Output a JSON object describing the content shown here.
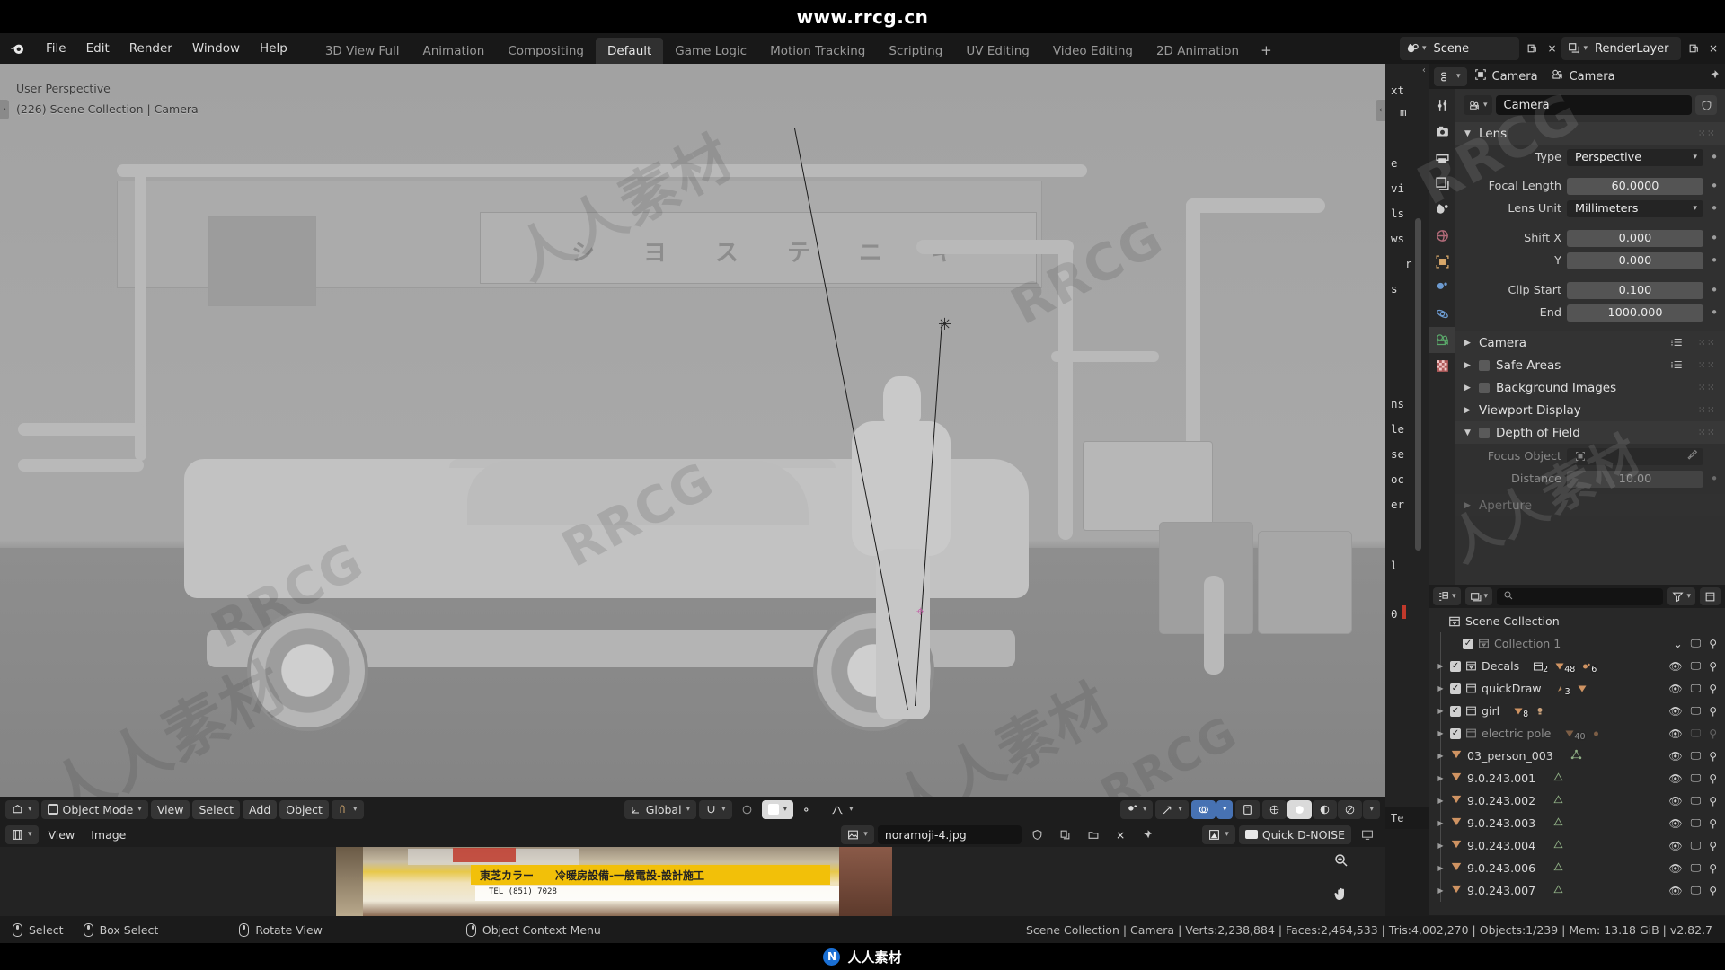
{
  "banner": {
    "text": "www.rrcg.cn"
  },
  "bottom_banner": {
    "text": "人人素材",
    "logo_glyph": "N"
  },
  "topbar": {
    "logo_icon": "blender-logo-icon",
    "menus": [
      "File",
      "Edit",
      "Render",
      "Window",
      "Help"
    ],
    "workspaces": [
      {
        "label": "3D View Full",
        "active": false
      },
      {
        "label": "Animation",
        "active": false
      },
      {
        "label": "Compositing",
        "active": false
      },
      {
        "label": "Default",
        "active": true
      },
      {
        "label": "Game Logic",
        "active": false
      },
      {
        "label": "Motion Tracking",
        "active": false
      },
      {
        "label": "Scripting",
        "active": false
      },
      {
        "label": "UV Editing",
        "active": false
      },
      {
        "label": "Video Editing",
        "active": false
      },
      {
        "label": "2D Animation",
        "active": false
      }
    ],
    "add_workspace": "+",
    "scene": {
      "icon": "scene-icon",
      "name": "Scene",
      "new_btn": "new-scene-icon",
      "unlink_btn": "×"
    },
    "view_layer": {
      "icon": "view-layer-icon",
      "name": "RenderLayer",
      "new_btn": "new-layer-icon",
      "remove_btn": "×"
    }
  },
  "viewport": {
    "perspective": "User Perspective",
    "scene_info": "(226) Scene Collection | Camera",
    "jp_sign_chars": [
      "シ",
      "ヨ",
      "ス",
      "テ",
      "ニ",
      "キ"
    ],
    "left_toggle_icon": "chevron-right-icon",
    "right_toggle_icon": "chevron-left-icon"
  },
  "viewport_footer": {
    "editor_type_icon": "editor-type-3dview-icon",
    "mode": "Object Mode",
    "menus": [
      "View",
      "Select",
      "Add",
      "Object"
    ],
    "object_mode_extra_icon": "mode-options-icon",
    "transform_orientation": "Global",
    "snap_icon": "snap-magnet-icon",
    "proportional_icon": "proportional-edit-icon",
    "falloff_icon": "falloff-curve-icon",
    "visibility_icon": "object-visibility-icon",
    "gizmo_icon": "gizmo-icon",
    "overlays_icon": "overlays-icon",
    "xray_icon": "xray-toggle-icon",
    "shading_modes": [
      "wireframe",
      "solid",
      "material-preview",
      "rendered"
    ],
    "active_shading": "solid"
  },
  "image_editor": {
    "editor_type_icon": "editor-type-image-icon",
    "menus": [
      "View",
      "Image"
    ],
    "image_datablock_icon": "image-datablock-icon",
    "image_name": "noramoji-4.jpg",
    "fake_user_icon": "shield-icon",
    "copy_icon": "duplicate-icon",
    "open_icon": "folder-open-icon",
    "unlink_icon": "×",
    "pin_icon": "pin-icon",
    "view_mode_icon": "image-view-mode-icon",
    "denoise_button": "Quick D-NOISE",
    "denoise_display_icon": "display-icon",
    "zoom_icon": "zoom-in-icon",
    "pan_icon": "hand-icon"
  },
  "text_strip": {
    "lines": [
      "xt",
      "m",
      "e",
      "vi",
      "ls",
      "ws",
      "r",
      "s",
      "ns",
      "le",
      "se",
      "oc",
      "er",
      "l",
      "0"
    ],
    "footer": "Te"
  },
  "properties": {
    "breadcrumb": [
      {
        "icon": "object-icon",
        "label": "Camera"
      },
      {
        "icon": "camera-data-icon",
        "label": "Camera"
      }
    ],
    "pin_icon": "pin-icon",
    "editor_type_icon": "editor-type-properties-icon",
    "datablock": {
      "icon": "camera-data-icon",
      "name": "Camera",
      "shield_icon": "shield-icon"
    },
    "tabs": [
      "tool-icon",
      "render-icon",
      "output-icon",
      "view-layer-icon",
      "scene-icon",
      "world-icon",
      "object-icon",
      "modifier-icon",
      "physics-icon",
      "object-data-camera-icon",
      "texture-icon"
    ],
    "active_tab": "object-data-camera-icon",
    "lens_panel": {
      "title": "Lens",
      "rows": [
        {
          "label": "Type",
          "value": "Perspective",
          "kind": "dropdown"
        },
        {
          "label": "Focal Length",
          "value": "60.0000",
          "kind": "number"
        },
        {
          "label": "Lens Unit",
          "value": "Millimeters",
          "kind": "dropdown"
        },
        {
          "label": "Shift X",
          "value": "0.000",
          "kind": "number"
        },
        {
          "label": "Y",
          "value": "0.000",
          "kind": "number"
        },
        {
          "label": "Clip Start",
          "value": "0.100",
          "kind": "number"
        },
        {
          "label": "End",
          "value": "1000.000",
          "kind": "number"
        }
      ]
    },
    "collapsed_panels": [
      {
        "title": "Camera",
        "checkbox": false,
        "has_list": true
      },
      {
        "title": "Safe Areas",
        "checkbox": true,
        "has_list": true
      },
      {
        "title": "Background Images",
        "checkbox": true,
        "has_list": false
      },
      {
        "title": "Viewport Display",
        "checkbox": false,
        "has_list": false
      }
    ],
    "dof_panel": {
      "title": "Depth of Field",
      "checkbox": true,
      "rows": [
        {
          "label": "Focus Object",
          "value": "",
          "kind": "object",
          "eyedropper": true
        },
        {
          "label": "Distance",
          "value": "10.00",
          "kind": "number"
        }
      ],
      "next_panel_partial": "Aperture"
    }
  },
  "outliner": {
    "display_mode_icon": "outliner-display-mode-icon",
    "filter_type_icon": "outliner-filter-type-icon",
    "search_placeholder": "",
    "search_icon": "search-icon",
    "filter_icon": "filter-funnel-icon",
    "root": "Scene Collection",
    "rows": [
      {
        "name": "Collection 1",
        "type": "collection",
        "muted": true,
        "checkbox": true,
        "expand": false,
        "badges": [],
        "eye": false,
        "screen": true,
        "camera": true
      },
      {
        "name": "Decals",
        "type": "collection",
        "muted": false,
        "checkbox": true,
        "expand": true,
        "badges": [
          {
            "icon": "collection-icon",
            "count": "2"
          },
          {
            "icon": "mesh-icon",
            "count": "48"
          },
          {
            "icon": "modifier-icon",
            "count": "6"
          }
        ],
        "eye": true,
        "screen": true,
        "camera": true
      },
      {
        "name": "quickDraw",
        "type": "collection",
        "muted": false,
        "checkbox": true,
        "expand": true,
        "badges": [
          {
            "icon": "armature-icon",
            "count": "3"
          },
          {
            "icon": "mesh-icon",
            "count": ""
          }
        ],
        "eye": true,
        "screen": true,
        "camera": true
      },
      {
        "name": "girl",
        "type": "collection",
        "muted": false,
        "checkbox": true,
        "expand": true,
        "badges": [
          {
            "icon": "mesh-icon",
            "count": "8"
          },
          {
            "icon": "light-icon",
            "count": ""
          }
        ],
        "eye": true,
        "screen": true,
        "camera": true
      },
      {
        "name": "electric pole",
        "type": "collection",
        "muted": true,
        "checkbox": true,
        "expand": true,
        "badges": [
          {
            "icon": "mesh-icon",
            "count": "40"
          },
          {
            "icon": "modifier-icon",
            "count": ""
          }
        ],
        "eye": true,
        "screen": false,
        "camera": false
      },
      {
        "name": "03_person_003",
        "type": "object",
        "muted": false,
        "checkbox": false,
        "expand": true,
        "badges": [
          {
            "icon": "mesh-data-icon",
            "count": ""
          }
        ],
        "eye": true,
        "screen": true,
        "camera": true
      },
      {
        "name": "9.0.243.001",
        "type": "object",
        "muted": false,
        "checkbox": false,
        "expand": true,
        "badges": [
          {
            "icon": "mesh-data-icon",
            "count": ""
          }
        ],
        "eye": true,
        "screen": true,
        "camera": true
      },
      {
        "name": "9.0.243.002",
        "type": "object",
        "muted": false,
        "checkbox": false,
        "expand": true,
        "badges": [
          {
            "icon": "mesh-data-icon",
            "count": ""
          }
        ],
        "eye": true,
        "screen": true,
        "camera": true
      },
      {
        "name": "9.0.243.003",
        "type": "object",
        "muted": false,
        "checkbox": false,
        "expand": true,
        "badges": [
          {
            "icon": "mesh-data-icon",
            "count": ""
          }
        ],
        "eye": true,
        "screen": true,
        "camera": true
      },
      {
        "name": "9.0.243.004",
        "type": "object",
        "muted": false,
        "checkbox": false,
        "expand": true,
        "badges": [
          {
            "icon": "mesh-data-icon",
            "count": ""
          }
        ],
        "eye": true,
        "screen": true,
        "camera": true
      },
      {
        "name": "9.0.243.006",
        "type": "object",
        "muted": false,
        "checkbox": false,
        "expand": true,
        "badges": [
          {
            "icon": "mesh-data-icon",
            "count": ""
          }
        ],
        "eye": true,
        "screen": true,
        "camera": true
      },
      {
        "name": "9.0.243.007",
        "type": "object",
        "muted": false,
        "checkbox": false,
        "expand": true,
        "badges": [
          {
            "icon": "mesh-data-icon",
            "count": ""
          }
        ],
        "eye": true,
        "screen": true,
        "camera": true
      }
    ]
  },
  "statusbar": {
    "keymap": [
      {
        "icon": "mouse-left-icon",
        "label": "Select"
      },
      {
        "icon": "mouse-left-drag-icon",
        "label": "Box Select"
      },
      {
        "icon": "mouse-middle-icon",
        "label": "Rotate View"
      },
      {
        "icon": "mouse-right-icon",
        "label": "Object Context Menu"
      }
    ],
    "stats": "Scene Collection | Camera | Verts:2,238,884 | Faces:2,464,533 | Tris:4,002,270 | Objects:1/239 | Mem: 13.18 GiB | v2.82.7"
  },
  "colors": {
    "accent_blue": "#4772b3",
    "panel_bg": "#303030",
    "header_bg": "#1d1d1d",
    "viewport_bg": "#a8a8a8",
    "mesh_orange": "#cf9362"
  }
}
